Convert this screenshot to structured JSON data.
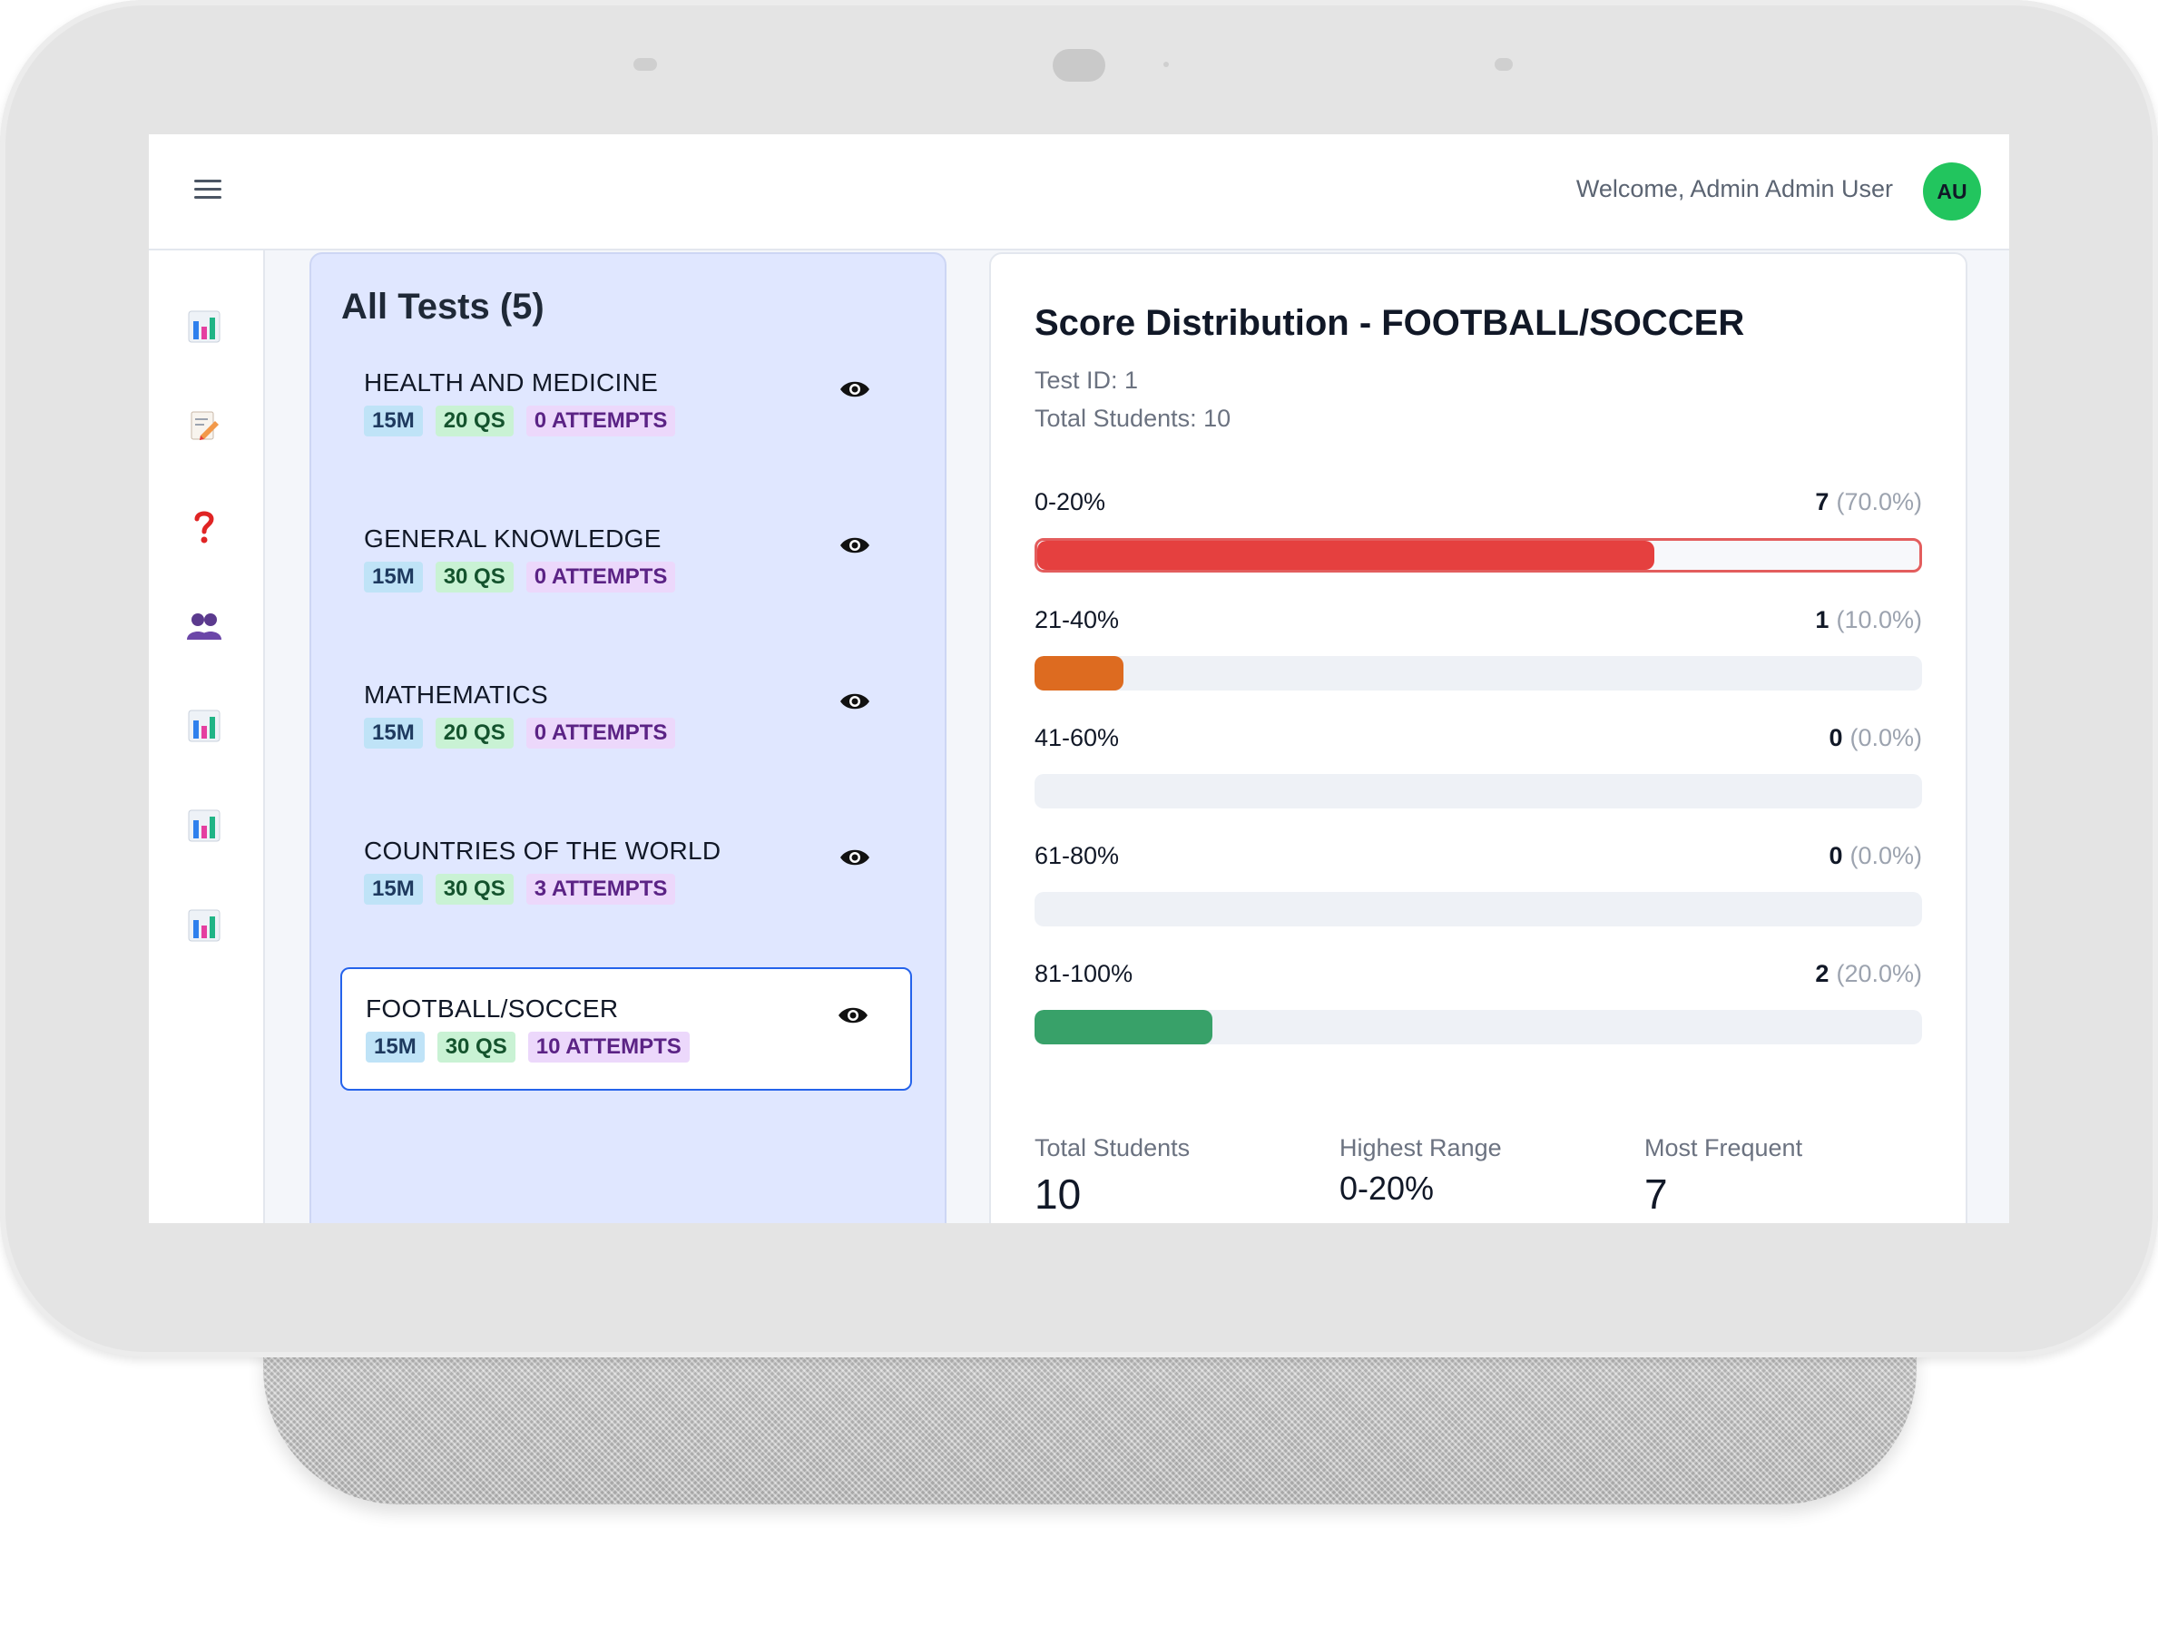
{
  "header": {
    "welcome_text": "Welcome, Admin Admin User",
    "avatar_initials": "AU"
  },
  "sidebar": {
    "icons": [
      "bar-chart-icon",
      "edit-memo-icon",
      "question-mark-icon",
      "users-icon",
      "bar-chart-icon",
      "bar-chart-icon",
      "bar-chart-icon"
    ]
  },
  "tests": {
    "title": "All Tests (5)",
    "items": [
      {
        "name": "HEALTH AND MEDICINE",
        "time": "15M",
        "questions": "20 QS",
        "attempts": "0 ATTEMPTS",
        "selected": false
      },
      {
        "name": "GENERAL KNOWLEDGE",
        "time": "15M",
        "questions": "30 QS",
        "attempts": "0 ATTEMPTS",
        "selected": false
      },
      {
        "name": "MATHEMATICS",
        "time": "15M",
        "questions": "20 QS",
        "attempts": "0 ATTEMPTS",
        "selected": false
      },
      {
        "name": "COUNTRIES OF THE WORLD",
        "time": "15M",
        "questions": "30 QS",
        "attempts": "3 ATTEMPTS",
        "selected": false
      },
      {
        "name": "FOOTBALL/SOCCER",
        "time": "15M",
        "questions": "30 QS",
        "attempts": "10 ATTEMPTS",
        "selected": true
      }
    ]
  },
  "distribution": {
    "title": "Score Distribution - FOOTBALL/SOCCER",
    "test_id": "Test ID: 1",
    "total_students_line": "Total Students: 10",
    "ranges": [
      {
        "label": "0-20%",
        "count": "7",
        "percent": "(70.0%)",
        "fraction": 0.7,
        "color": "#e5403f"
      },
      {
        "label": "21-40%",
        "count": "1",
        "percent": "(10.0%)",
        "fraction": 0.1,
        "color": "#dd6b20"
      },
      {
        "label": "41-60%",
        "count": "0",
        "percent": "(0.0%)",
        "fraction": 0.0,
        "color": "#d69e2e"
      },
      {
        "label": "61-80%",
        "count": "0",
        "percent": "(0.0%)",
        "fraction": 0.0,
        "color": "#3182ce"
      },
      {
        "label": "81-100%",
        "count": "2",
        "percent": "(20.0%)",
        "fraction": 0.2,
        "color": "#38a169"
      }
    ],
    "stats": {
      "total_label": "Total Students",
      "total_value": "10",
      "highest_label": "Highest Range",
      "highest_value": "0-20%",
      "frequent_label": "Most Frequent",
      "frequent_value": "7"
    }
  }
}
